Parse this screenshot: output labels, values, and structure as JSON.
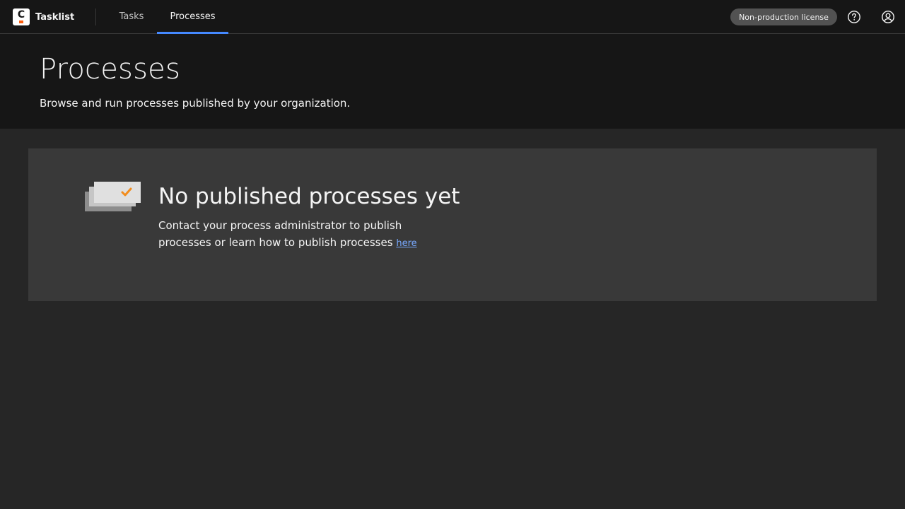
{
  "app": {
    "name": "Tasklist",
    "logo_letter": "C"
  },
  "nav": {
    "items": [
      {
        "label": "Tasks",
        "active": false
      },
      {
        "label": "Processes",
        "active": true
      }
    ]
  },
  "header_actions": {
    "license_label": "Non-production license",
    "help_icon": "help-circle-icon",
    "user_icon": "user-avatar-icon"
  },
  "page": {
    "title": "Processes",
    "subtitle": "Browse and run processes published by your organization."
  },
  "empty_state": {
    "illustration_icon": "stacked-cards-checkmark-icon",
    "title": "No published processes yet",
    "text": "Contact your process administrator to publish processes or learn how to publish processes",
    "link_label": "here"
  },
  "colors": {
    "topbar_bg": "#161616",
    "page_bg": "#262626",
    "card_bg": "#393939",
    "accent_blue": "#4589ff",
    "link_blue": "#78a9ff",
    "brand_orange": "#fc5d0d",
    "check_orange": "#f28c1b"
  }
}
